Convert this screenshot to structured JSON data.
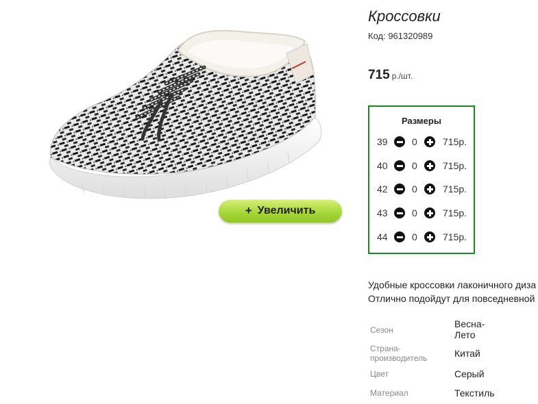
{
  "product": {
    "title": "Кроссовки",
    "code": "Код: 961320989",
    "price": {
      "amount": "715",
      "unit": "р./шт."
    },
    "zoom_button": {
      "icon": "plus-icon",
      "label": "Увеличить"
    }
  },
  "sizes": {
    "title": "Размеры",
    "border_color": "#1b8a1b",
    "rows": [
      {
        "size": "39",
        "qty": "0",
        "price": "715р."
      },
      {
        "size": "40",
        "qty": "0",
        "price": "715р."
      },
      {
        "size": "42",
        "qty": "0",
        "price": "715р."
      },
      {
        "size": "43",
        "qty": "0",
        "price": "715р."
      },
      {
        "size": "44",
        "qty": "0",
        "price": "715р."
      }
    ]
  },
  "description": {
    "line1": "Удобные кроссовки лаконичного диза",
    "line2": "Отлично подойдут для повседневной"
  },
  "attributes": {
    "season": {
      "label": "Сезон",
      "value_line1": "Весна-",
      "value_line2": "Лето"
    },
    "country": {
      "label_line1": "Страна-",
      "label_line2": "производитель",
      "value": "Китай"
    },
    "color": {
      "label": "Цвет",
      "value": "Серый"
    },
    "material": {
      "label": "Материал",
      "value": "Текстиль"
    }
  }
}
